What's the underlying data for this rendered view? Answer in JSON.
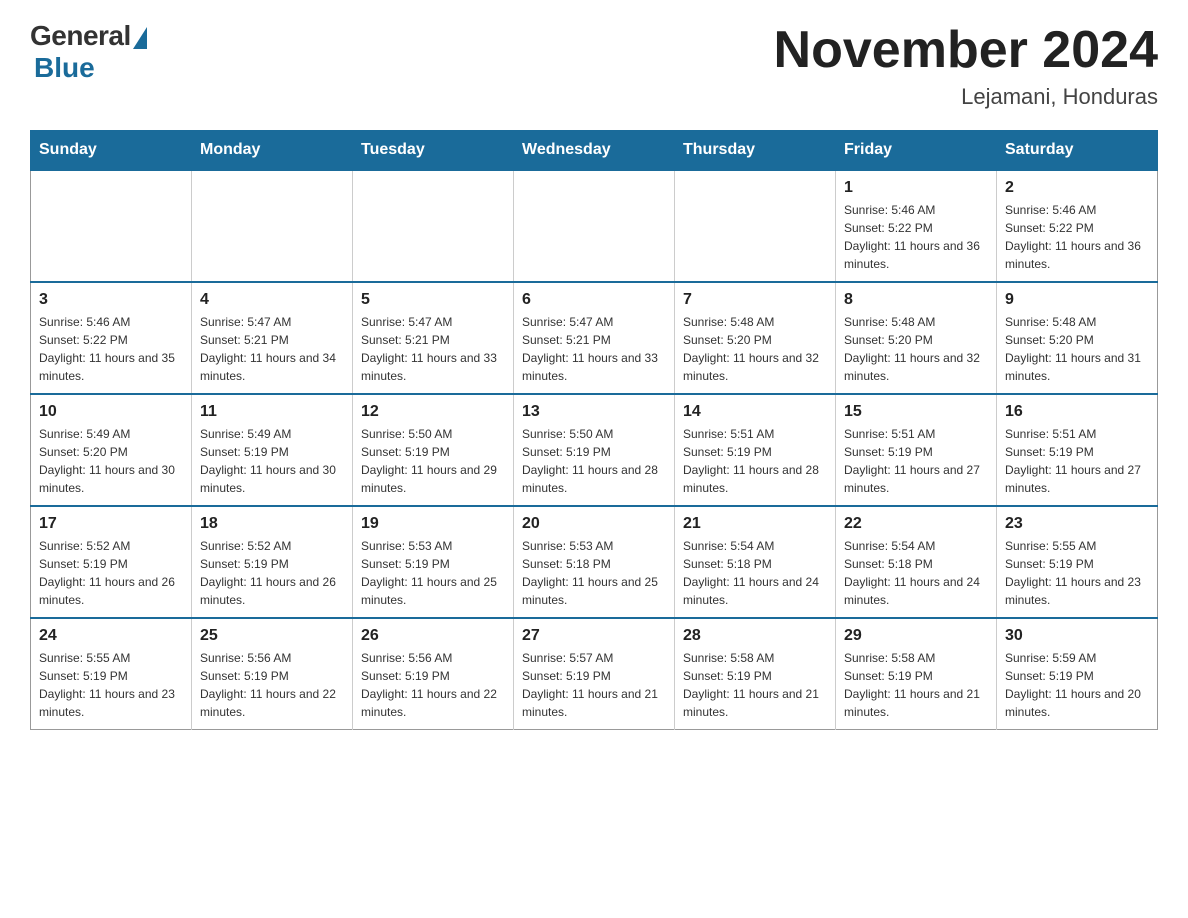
{
  "logo": {
    "general": "General",
    "blue": "Blue",
    "subtitle": "Blue"
  },
  "header": {
    "month_title": "November 2024",
    "location": "Lejamani, Honduras"
  },
  "days_of_week": [
    "Sunday",
    "Monday",
    "Tuesday",
    "Wednesday",
    "Thursday",
    "Friday",
    "Saturday"
  ],
  "weeks": [
    [
      {
        "day": "",
        "info": ""
      },
      {
        "day": "",
        "info": ""
      },
      {
        "day": "",
        "info": ""
      },
      {
        "day": "",
        "info": ""
      },
      {
        "day": "",
        "info": ""
      },
      {
        "day": "1",
        "info": "Sunrise: 5:46 AM\nSunset: 5:22 PM\nDaylight: 11 hours and 36 minutes."
      },
      {
        "day": "2",
        "info": "Sunrise: 5:46 AM\nSunset: 5:22 PM\nDaylight: 11 hours and 36 minutes."
      }
    ],
    [
      {
        "day": "3",
        "info": "Sunrise: 5:46 AM\nSunset: 5:22 PM\nDaylight: 11 hours and 35 minutes."
      },
      {
        "day": "4",
        "info": "Sunrise: 5:47 AM\nSunset: 5:21 PM\nDaylight: 11 hours and 34 minutes."
      },
      {
        "day": "5",
        "info": "Sunrise: 5:47 AM\nSunset: 5:21 PM\nDaylight: 11 hours and 33 minutes."
      },
      {
        "day": "6",
        "info": "Sunrise: 5:47 AM\nSunset: 5:21 PM\nDaylight: 11 hours and 33 minutes."
      },
      {
        "day": "7",
        "info": "Sunrise: 5:48 AM\nSunset: 5:20 PM\nDaylight: 11 hours and 32 minutes."
      },
      {
        "day": "8",
        "info": "Sunrise: 5:48 AM\nSunset: 5:20 PM\nDaylight: 11 hours and 32 minutes."
      },
      {
        "day": "9",
        "info": "Sunrise: 5:48 AM\nSunset: 5:20 PM\nDaylight: 11 hours and 31 minutes."
      }
    ],
    [
      {
        "day": "10",
        "info": "Sunrise: 5:49 AM\nSunset: 5:20 PM\nDaylight: 11 hours and 30 minutes."
      },
      {
        "day": "11",
        "info": "Sunrise: 5:49 AM\nSunset: 5:19 PM\nDaylight: 11 hours and 30 minutes."
      },
      {
        "day": "12",
        "info": "Sunrise: 5:50 AM\nSunset: 5:19 PM\nDaylight: 11 hours and 29 minutes."
      },
      {
        "day": "13",
        "info": "Sunrise: 5:50 AM\nSunset: 5:19 PM\nDaylight: 11 hours and 28 minutes."
      },
      {
        "day": "14",
        "info": "Sunrise: 5:51 AM\nSunset: 5:19 PM\nDaylight: 11 hours and 28 minutes."
      },
      {
        "day": "15",
        "info": "Sunrise: 5:51 AM\nSunset: 5:19 PM\nDaylight: 11 hours and 27 minutes."
      },
      {
        "day": "16",
        "info": "Sunrise: 5:51 AM\nSunset: 5:19 PM\nDaylight: 11 hours and 27 minutes."
      }
    ],
    [
      {
        "day": "17",
        "info": "Sunrise: 5:52 AM\nSunset: 5:19 PM\nDaylight: 11 hours and 26 minutes."
      },
      {
        "day": "18",
        "info": "Sunrise: 5:52 AM\nSunset: 5:19 PM\nDaylight: 11 hours and 26 minutes."
      },
      {
        "day": "19",
        "info": "Sunrise: 5:53 AM\nSunset: 5:19 PM\nDaylight: 11 hours and 25 minutes."
      },
      {
        "day": "20",
        "info": "Sunrise: 5:53 AM\nSunset: 5:18 PM\nDaylight: 11 hours and 25 minutes."
      },
      {
        "day": "21",
        "info": "Sunrise: 5:54 AM\nSunset: 5:18 PM\nDaylight: 11 hours and 24 minutes."
      },
      {
        "day": "22",
        "info": "Sunrise: 5:54 AM\nSunset: 5:18 PM\nDaylight: 11 hours and 24 minutes."
      },
      {
        "day": "23",
        "info": "Sunrise: 5:55 AM\nSunset: 5:19 PM\nDaylight: 11 hours and 23 minutes."
      }
    ],
    [
      {
        "day": "24",
        "info": "Sunrise: 5:55 AM\nSunset: 5:19 PM\nDaylight: 11 hours and 23 minutes."
      },
      {
        "day": "25",
        "info": "Sunrise: 5:56 AM\nSunset: 5:19 PM\nDaylight: 11 hours and 22 minutes."
      },
      {
        "day": "26",
        "info": "Sunrise: 5:56 AM\nSunset: 5:19 PM\nDaylight: 11 hours and 22 minutes."
      },
      {
        "day": "27",
        "info": "Sunrise: 5:57 AM\nSunset: 5:19 PM\nDaylight: 11 hours and 21 minutes."
      },
      {
        "day": "28",
        "info": "Sunrise: 5:58 AM\nSunset: 5:19 PM\nDaylight: 11 hours and 21 minutes."
      },
      {
        "day": "29",
        "info": "Sunrise: 5:58 AM\nSunset: 5:19 PM\nDaylight: 11 hours and 21 minutes."
      },
      {
        "day": "30",
        "info": "Sunrise: 5:59 AM\nSunset: 5:19 PM\nDaylight: 11 hours and 20 minutes."
      }
    ]
  ]
}
